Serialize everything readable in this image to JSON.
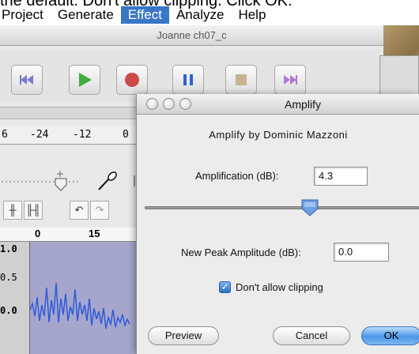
{
  "caption": "the default. Don't allow clipping. Click OK.",
  "menubar": {
    "items": [
      "Project",
      "Generate",
      "Effect",
      "Analyze",
      "Help"
    ],
    "active_index": 2
  },
  "main_window": {
    "title": "Joanne ch07_c",
    "transport_icons": [
      "skip-start-icon",
      "play-icon",
      "record-icon",
      "pause-icon",
      "stop-icon",
      "skip-end-icon"
    ],
    "meter_ticks": [
      "6",
      "-24",
      "-12",
      "0"
    ],
    "edit_icons": [
      "trim-icon",
      "silence-icon",
      "undo-icon",
      "redo-icon"
    ],
    "ruler_ticks": [
      "0",
      "15"
    ],
    "track_ticks": [
      "1.0",
      "0.5",
      "0.0"
    ]
  },
  "dialog": {
    "title": "Amplify",
    "heading": "Amplify by Dominic Mazzoni",
    "amplification_label": "Amplification (dB):",
    "amplification_value": "4.3",
    "peak_label": "New Peak Amplitude (dB):",
    "peak_value": "0.0",
    "clipping_label": "Don't allow clipping",
    "clipping_checked": true,
    "preview_label": "Preview",
    "cancel_label": "Cancel",
    "ok_label": "OK",
    "accent_color": "#3a76c7"
  }
}
